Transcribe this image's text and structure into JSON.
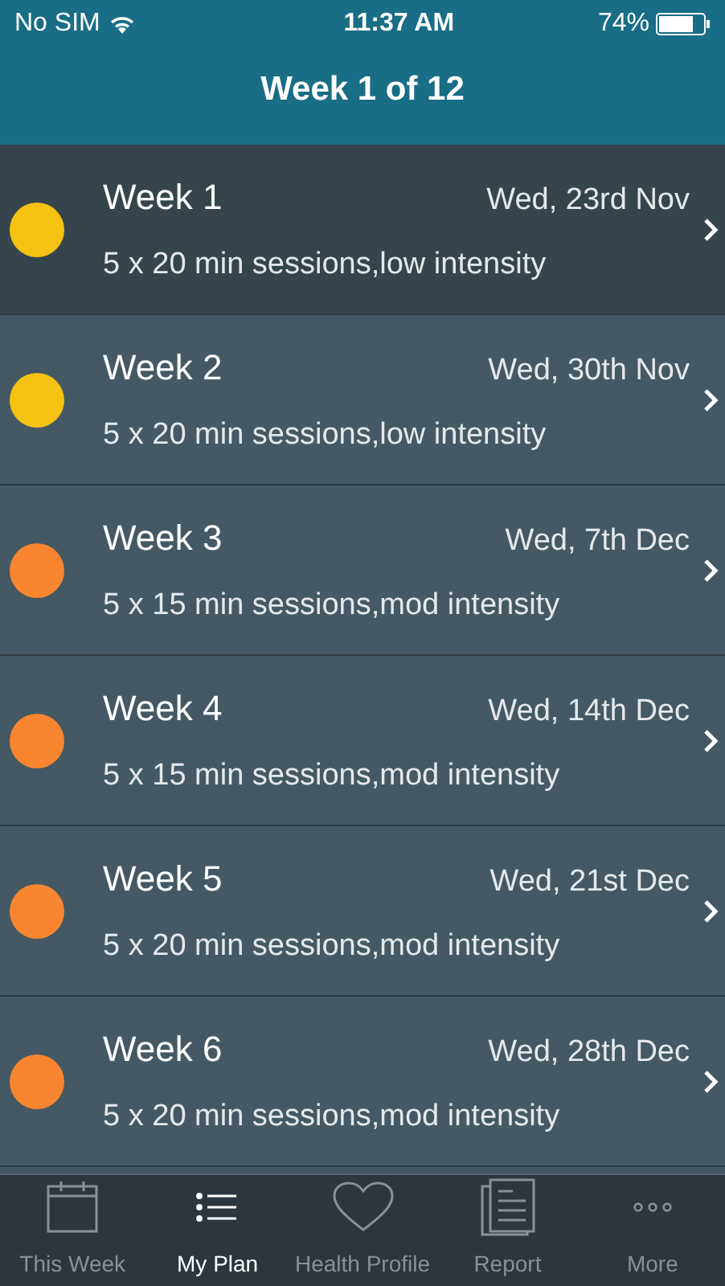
{
  "status_bar": {
    "carrier": "No SIM",
    "time": "11:37 AM",
    "battery": "74%"
  },
  "nav": {
    "title": "Week 1 of 12"
  },
  "weeks": [
    {
      "title": "Week 1",
      "date": "Wed, 23rd Nov",
      "detail": "5 x 20 min sessions,low intensity",
      "color": "#f5c211",
      "selected": true
    },
    {
      "title": "Week 2",
      "date": "Wed, 30th Nov",
      "detail": "5 x 20 min sessions,low intensity",
      "color": "#f5c211",
      "selected": false
    },
    {
      "title": "Week 3",
      "date": "Wed, 7th Dec",
      "detail": "5 x 15 min sessions,mod intensity",
      "color": "#f8852f",
      "selected": false
    },
    {
      "title": "Week 4",
      "date": "Wed, 14th Dec",
      "detail": "5 x 15 min sessions,mod intensity",
      "color": "#f8852f",
      "selected": false
    },
    {
      "title": "Week 5",
      "date": "Wed, 21st Dec",
      "detail": "5 x 20 min sessions,mod intensity",
      "color": "#f8852f",
      "selected": false
    },
    {
      "title": "Week 6",
      "date": "Wed, 28th Dec",
      "detail": "5 x 20 min sessions,mod intensity",
      "color": "#f8852f",
      "selected": false
    }
  ],
  "tabs": [
    {
      "label": "This Week",
      "kind": "calendar",
      "selected": false
    },
    {
      "label": "My Plan",
      "kind": "list",
      "selected": true
    },
    {
      "label": "Health Profile",
      "kind": "heart",
      "selected": false
    },
    {
      "label": "Report",
      "kind": "report",
      "selected": false
    },
    {
      "label": "More",
      "kind": "more",
      "selected": false
    }
  ]
}
